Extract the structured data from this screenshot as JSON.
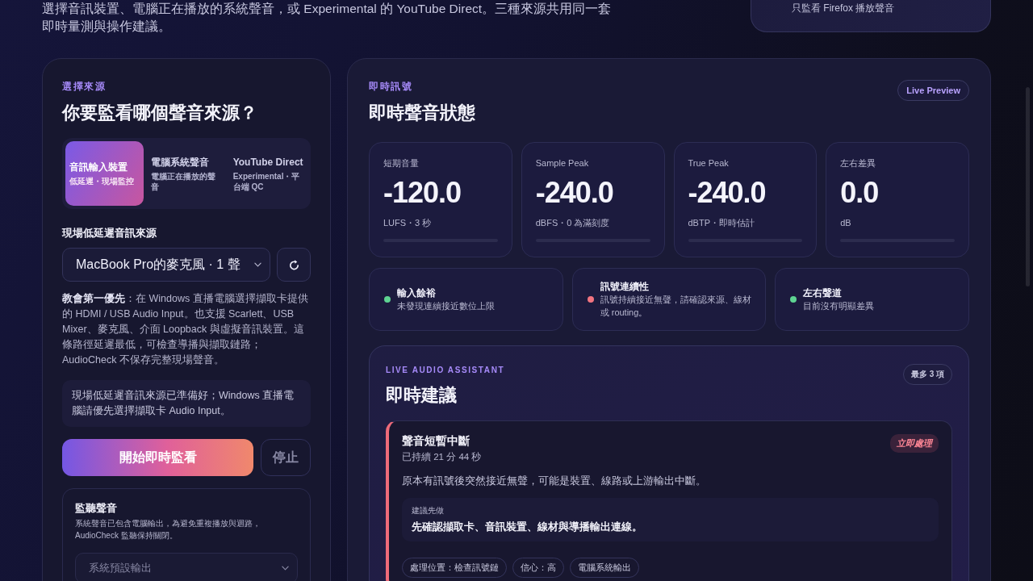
{
  "intro": {
    "text": "選擇音訊裝置、電腦正在播放的系統聲音，或 Experimental 的 YouTube Direct。三種來源共用同一套即時量測與操作建議。"
  },
  "scope_card": {
    "text": "只監看 Firefox 播放聲音"
  },
  "source_panel": {
    "eyebrow": "選擇來源",
    "title": "你要監看哪個聲音來源？",
    "tabs": [
      {
        "label": "音訊輸入裝置",
        "sub": "低延遲・現場監控",
        "selected": true
      },
      {
        "label": "電腦系統聲音",
        "sub": "電腦正在播放的聲音",
        "selected": false
      },
      {
        "label": "YouTube Direct",
        "sub": "Experimental・平台端 QC",
        "selected": false
      }
    ],
    "field_label": "現場低延遲音訊來源",
    "device_select": {
      "value": "MacBook Pro的麥克風 · 1 聲"
    },
    "help": "**教會第一優先**：在 Windows 直播電腦選擇擷取卡提供的 HDMI / USB Audio Input。也支援 Scarlett、USB Mixer、麥克風、介面 Loopback 與虛擬音訊裝置。這條路徑延遲最低，可檢查導播與擷取鏈路；AudioCheck 不保存完整現場聲音。",
    "note": "現場低延遲音訊來源已準備好；Windows 直播電腦請優先選擇擷取卡 Audio Input。",
    "buttons": [
      {
        "label": "開始即時監看",
        "kind": "primary",
        "disabled": false
      },
      {
        "label": "停止",
        "kind": "secondary",
        "disabled": true
      }
    ],
    "monitor": {
      "title": "監聽聲音",
      "description": "系統聲音已包含電腦輸出，為避免重複播放與迴路，AudioCheck 監聽保持關閉。",
      "output_select": {
        "value": "系統預設輸出",
        "disabled": true
      }
    }
  },
  "signal_panel": {
    "eyebrow": "即時訊號",
    "title": "即時聲音狀態",
    "badge": "Live Preview",
    "metrics": [
      {
        "label": "短期音量",
        "value": "-120.0",
        "unit": "LUFS・3 秒"
      },
      {
        "label": "Sample Peak",
        "value": "-240.0",
        "unit": "dBFS・0 為滿刻度"
      },
      {
        "label": "True Peak",
        "value": "-240.0",
        "unit": "dBTP・即時估計"
      },
      {
        "label": "左右差異",
        "value": "0.0",
        "unit": "dB"
      }
    ],
    "checks": [
      {
        "title": "輸入餘裕",
        "detail": "未發現連續接近數位上限",
        "color": "#5ed492"
      },
      {
        "title": "訊號連續性",
        "detail": "訊號持續接近無聲，請確認來源、線材或 routing。",
        "color": "#f27480"
      },
      {
        "title": "左右聲道",
        "detail": "目前沒有明顯差異",
        "color": "#5ed492"
      }
    ]
  },
  "assistant": {
    "eyebrow": "LIVE AUDIO ASSISTANT",
    "title": "即時建議",
    "badge": "最多 3 項",
    "suggestions": [
      {
        "title": "聲音短暫中斷",
        "duration": "已持續 21 分 44 秒",
        "priority": "立即處理",
        "urgent": true,
        "description": "原本有訊號後突然接近無聲，可能是裝置、線路或上游輸出中斷。",
        "action_label": "建議先做",
        "action": "先確認擷取卡、音訊裝置、線材與導播輸出連線。",
        "tags": [
          "處理位置：檢查訊號鏈",
          "信心：高",
          "電腦系統輸出"
        ]
      }
    ]
  }
}
